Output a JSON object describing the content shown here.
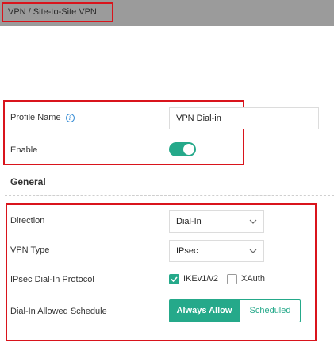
{
  "breadcrumb": "VPN / Site-to-Site VPN",
  "profile": {
    "name_label": "Profile Name",
    "name_value": "VPN Dial-in",
    "enable_label": "Enable",
    "enable_on": true
  },
  "general": {
    "title": "General",
    "direction_label": "Direction",
    "direction_value": "Dial-In",
    "vpn_type_label": "VPN Type",
    "vpn_type_value": "IPsec",
    "protocol_label": "IPsec Dial-In Protocol",
    "protocol_options": [
      {
        "label": "IKEv1/v2",
        "checked": true
      },
      {
        "label": "XAuth",
        "checked": false
      }
    ],
    "schedule_label": "Dial-In Allowed Schedule",
    "schedule_options": [
      "Always Allow",
      "Scheduled"
    ],
    "schedule_selected": "Always Allow"
  },
  "colors": {
    "accent": "#25a98a",
    "highlight": "#d9141c",
    "topbar": "#9b9b9b",
    "info": "#3a8fd6"
  },
  "icons": [
    "info-icon",
    "chevron-down-icon",
    "check-icon"
  ]
}
